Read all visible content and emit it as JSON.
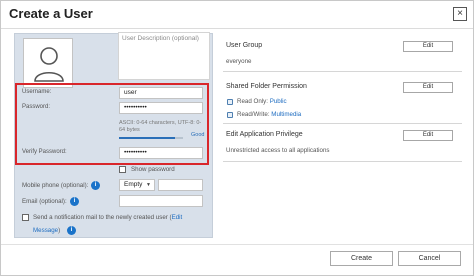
{
  "dialog": {
    "title": "Create a User",
    "close_glyph": "×"
  },
  "left": {
    "description_placeholder": "User Description (optional)",
    "username": {
      "label": "Username:",
      "value": "user"
    },
    "password": {
      "label": "Password:",
      "value": "••••••••••"
    },
    "hint": "ASCII: 0-64 characters, UTF-8: 0-64 bytes",
    "strength": {
      "label": "Good",
      "level": 0.88
    },
    "verify_password": {
      "label": "Verify Password:",
      "value": "••••••••••"
    },
    "show_password_label": "Show password",
    "mobile": {
      "label": "Mobile phone (optional):",
      "country_value": "Empty",
      "value": ""
    },
    "email": {
      "label": "Email (optional):",
      "value": ""
    },
    "notify": {
      "label": "Send a notification mail to the newly created user (",
      "link_part1": "Edit",
      "link_part2": "Message",
      "close_paren": ")"
    }
  },
  "right": {
    "user_group": {
      "title": "User Group",
      "edit_label": "Edit",
      "value": "everyone"
    },
    "shared_folder": {
      "title": "Shared Folder Permission",
      "edit_label": "Edit",
      "read_only_label": "Read Only:",
      "read_only_value": "Public",
      "read_write_label": "Read/Write:",
      "read_write_value": "Multimedia"
    },
    "app_privilege": {
      "title": "Edit Application Privilege",
      "edit_label": "Edit",
      "value": "Unrestricted access to all applications"
    }
  },
  "footer": {
    "create_label": "Create",
    "cancel_label": "Cancel"
  },
  "colors": {
    "highlight_border": "#d9262b",
    "link": "#1d6cc0",
    "info_icon": "#1a73c9",
    "panel_bg": "#d8e0ea"
  },
  "icons": {
    "info": "info-icon",
    "avatar": "user-silhouette-icon",
    "folder": "folder-icon"
  }
}
